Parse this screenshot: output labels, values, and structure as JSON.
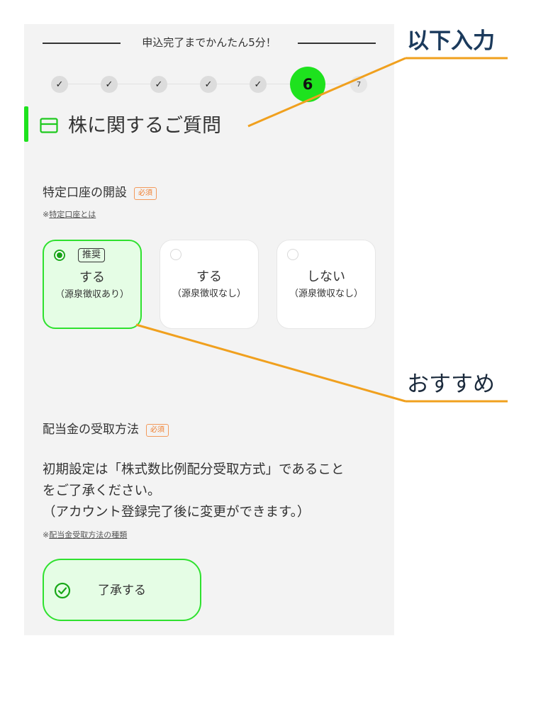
{
  "progress_header": "申込完了までかんたん5分！",
  "steps": [
    {
      "label": "✓",
      "state": "done"
    },
    {
      "label": "✓",
      "state": "done"
    },
    {
      "label": "✓",
      "state": "done"
    },
    {
      "label": "✓",
      "state": "done"
    },
    {
      "label": "✓",
      "state": "done"
    },
    {
      "label": "6",
      "state": "active"
    },
    {
      "label": "7",
      "state": "todo"
    }
  ],
  "section": {
    "title": "株に関するご質問",
    "icon": "card-icon"
  },
  "tokutei": {
    "label": "特定口座の開設",
    "required_badge": "必須",
    "link_prefix": "※",
    "link_text": "特定口座とは",
    "options": [
      {
        "tag": "推奨",
        "main": "する",
        "sub": "（源泉徴収あり）",
        "selected": true
      },
      {
        "tag": "",
        "main": "する",
        "sub": "（源泉徴収なし）",
        "selected": false
      },
      {
        "tag": "",
        "main": "しない",
        "sub": "（源泉徴収なし）",
        "selected": false
      }
    ]
  },
  "dividend": {
    "label": "配当金の受取方法",
    "required_badge": "必須",
    "line1": "初期設定は「株式数比例配分受取方式」であること",
    "line2": "をご了承ください。",
    "line3": "（アカウント登録完了後に変更ができます。）",
    "link_prefix": "※",
    "link_text": "配当金受取方法の種類",
    "accept_label": "了承する"
  },
  "annotations": {
    "top": "以下入力",
    "middle": "おすすめ",
    "line_color": "#f0a01e"
  },
  "colors": {
    "accent": "#1ee21e",
    "selected_bg": "#e5fde5",
    "badge": "#f07d2c"
  }
}
